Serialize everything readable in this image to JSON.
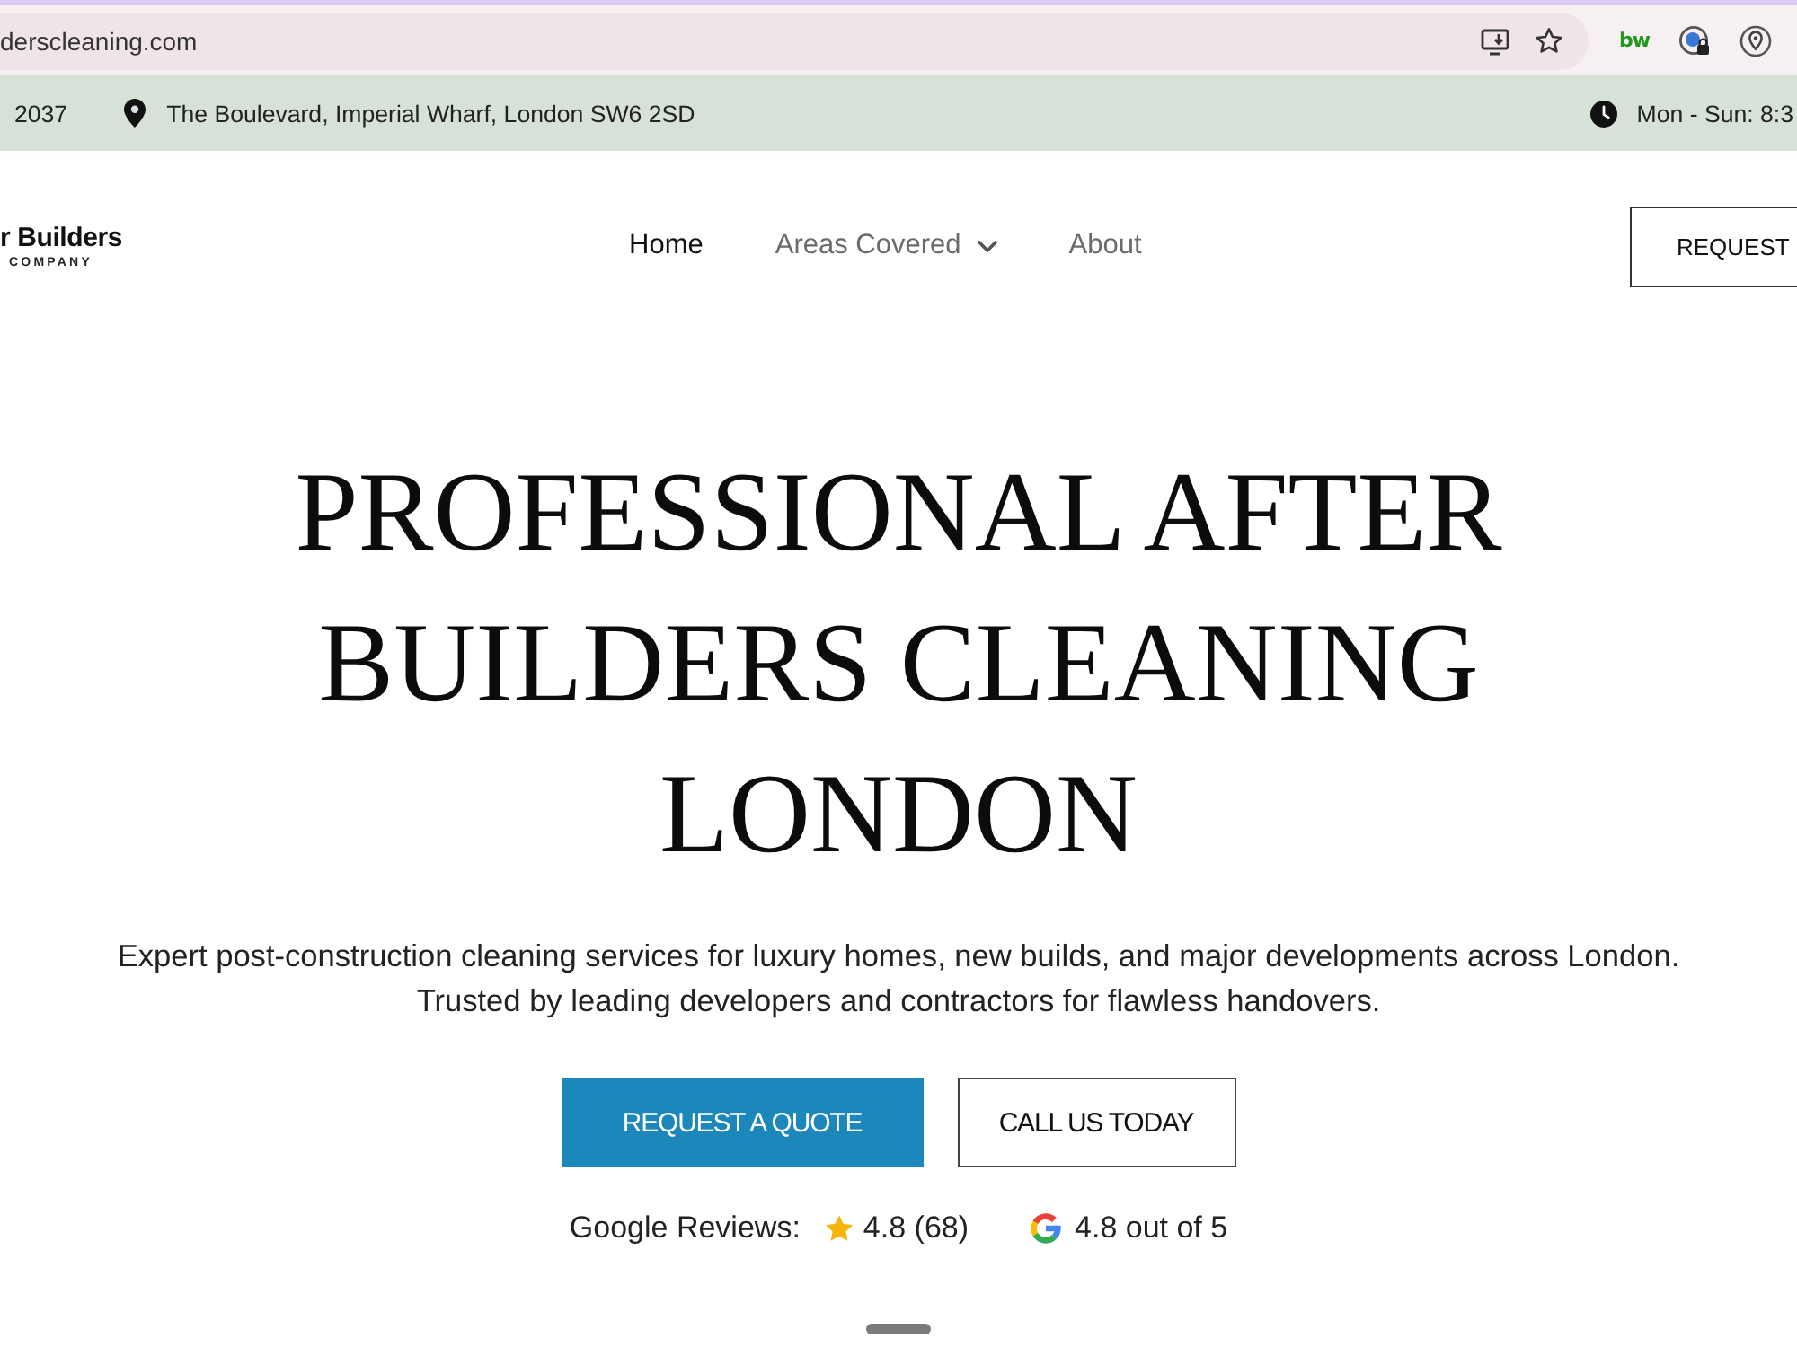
{
  "browser": {
    "url": "derscleaning.com",
    "extension_label": "bw"
  },
  "top_bar": {
    "phone": "2037",
    "address": "The Boulevard, Imperial Wharf, London SW6 2SD",
    "hours": "Mon - Sun: 8:3"
  },
  "header": {
    "logo": {
      "name": "r Builders",
      "tagline": "COMPANY"
    },
    "nav": [
      {
        "label": "Home",
        "kind": "link",
        "selected": true
      },
      {
        "label": "Areas Covered",
        "kind": "dropdown",
        "selected": false
      },
      {
        "label": "About",
        "kind": "link",
        "selected": false
      }
    ],
    "cta": "REQUEST"
  },
  "hero": {
    "title": "PROFESSIONAL AFTER BUILDERS CLEANING LONDON",
    "subtitle": "Expert post-construction cleaning services for luxury homes, new builds, and major developments across London. Trusted by leading developers and contractors for flawless handovers.",
    "buttons": [
      {
        "label": "REQUEST A QUOTE",
        "kind": "primary"
      },
      {
        "label": "CALL US TODAY",
        "kind": "outline"
      }
    ],
    "reviews": {
      "label": "Google Reviews:",
      "rating": "4.8 (68)",
      "google_rating": "4.8 out of 5"
    }
  }
}
